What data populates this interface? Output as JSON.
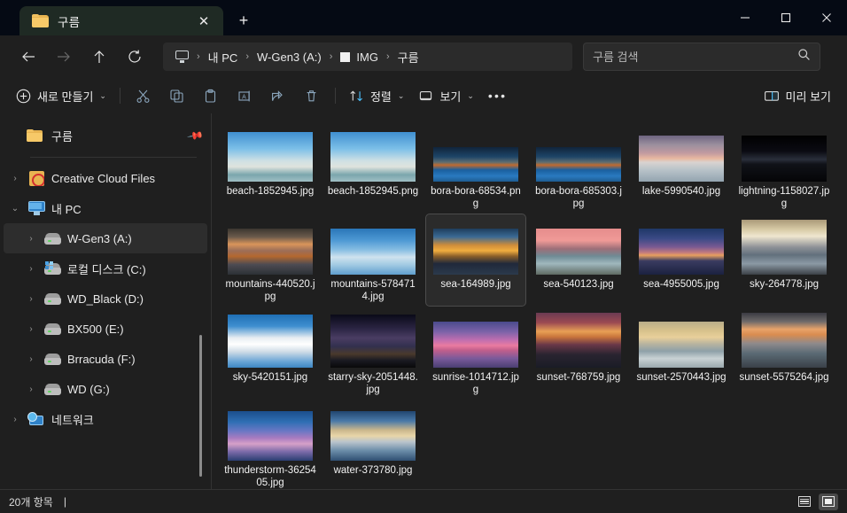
{
  "window": {
    "titlebar_color": "#050a14",
    "controls": [
      {
        "name": "minimize",
        "glyph": "minimize-icon"
      },
      {
        "name": "maximize",
        "glyph": "maximize-icon"
      },
      {
        "name": "close",
        "glyph": "close-icon"
      }
    ]
  },
  "tab": {
    "title": "구름",
    "icon": "folder-icon",
    "close_label": "✕",
    "newtab_label": "+"
  },
  "nav": {
    "back": "←",
    "forward": "→",
    "up": "↑",
    "refresh": "⟳"
  },
  "breadcrumb": {
    "items": [
      {
        "icon": "monitor-icon",
        "label": ""
      },
      {
        "icon": "",
        "label": "내 PC"
      },
      {
        "icon": "",
        "label": "W-Gen3 (A:)"
      },
      {
        "icon": "white-square-icon",
        "label": "IMG"
      },
      {
        "icon": "",
        "label": "구름"
      }
    ],
    "separator": "›"
  },
  "search": {
    "placeholder": "구름 검색",
    "value": "",
    "icon": "search-icon"
  },
  "toolbar": {
    "new_label": "새로 만들기",
    "chevron": "⌄",
    "cut_icon": "scissors-icon",
    "copy_icon": "copy-icon",
    "paste_icon": "clipboard-icon",
    "rename_icon": "rename-icon",
    "share_icon": "share-icon",
    "delete_icon": "trash-icon",
    "sort_label": "정렬",
    "view_label": "보기",
    "more_label": "•••",
    "preview_label": "미리 보기",
    "accent_color": "#4cc2ff"
  },
  "sidebar": {
    "pinned": {
      "label": "구름",
      "icon": "folder-icon",
      "pin_icon": "pin-icon"
    },
    "items": [
      {
        "label": "Creative Cloud Files",
        "icon": "creative-cloud-icon",
        "chevron": "›",
        "indent": 0,
        "selected": false
      },
      {
        "label": "내 PC",
        "icon": "this-pc-icon",
        "chevron": "⌄",
        "indent": 0,
        "selected": false
      },
      {
        "label": "W-Gen3 (A:)",
        "icon": "drive-icon",
        "chevron": "›",
        "indent": 1,
        "selected": true
      },
      {
        "label": "로컬 디스크 (C:)",
        "icon": "windows-drive-icon",
        "chevron": "›",
        "indent": 1,
        "selected": false
      },
      {
        "label": "WD_Black (D:)",
        "icon": "drive-icon",
        "chevron": "›",
        "indent": 1,
        "selected": false
      },
      {
        "label": "BX500 (E:)",
        "icon": "drive-icon",
        "chevron": "›",
        "indent": 1,
        "selected": false
      },
      {
        "label": "Brracuda (F:)",
        "icon": "drive-icon",
        "chevron": "›",
        "indent": 1,
        "selected": false
      },
      {
        "label": "WD (G:)",
        "icon": "drive-icon",
        "chevron": "›",
        "indent": 1,
        "selected": false
      },
      {
        "label": "네트워크",
        "icon": "network-icon",
        "chevron": "›",
        "indent": 0,
        "selected": false
      }
    ]
  },
  "files": [
    {
      "name": "beach-1852945.jpg",
      "selected": false,
      "w": 96,
      "h": 56,
      "grad": "linear-gradient(#3f8fd0 0%,#7dc0e8 34%,#cfe0e4 58%,#dfe3de 70%,#7ba6ad 86%,#9fbfc4 100%)"
    },
    {
      "name": "beach-1852945.png",
      "selected": false,
      "w": 96,
      "h": 56,
      "grad": "linear-gradient(#3f8fd0 0%,#7dc0e8 34%,#cfe0e4 58%,#dfe3de 70%,#7ba6ad 86%,#9fbfc4 100%)"
    },
    {
      "name": "bora-bora-68534.png",
      "selected": false,
      "w": 96,
      "h": 39,
      "grad": "linear-gradient(#10243a 0%,#1d4568 28%,#5f6d70 44%,#c06b30 52%,#1a5f9e 66%,#2a7ac0 84%,#1e5c91 100%)"
    },
    {
      "name": "bora-bora-685303.jpg",
      "selected": false,
      "w": 96,
      "h": 39,
      "grad": "linear-gradient(#10243a 0%,#1d4568 28%,#5f6d70 44%,#c06b30 52%,#1a5f9e 66%,#2a7ac0 84%,#1e5c91 100%)"
    },
    {
      "name": "lake-5990540.jpg",
      "selected": false,
      "w": 96,
      "h": 52,
      "grad": "linear-gradient(#6d6480 0%,#9b8f9e 20%,#c29aa0 38%,#e8b8a0 50%,#d9d3d0 58%,#b9c3c9 74%,#93a4b0 100%)"
    },
    {
      "name": "lightning-1158027.jpg",
      "selected": false,
      "w": 96,
      "h": 52,
      "grad": "linear-gradient(#000000 0%,#0b0b12 34%,#2a2f3b 52%,#101218 62%,#050507 100%)"
    },
    {
      "name": "mountains-440520.jpg",
      "selected": false,
      "w": 96,
      "h": 52,
      "grad": "linear-gradient(#3b3630 0%,#6a5a4c 18%,#d9955a 34%,#9c6e58 48%,#b4682f 60%,#4d4b52 78%,#2c3136 100%)"
    },
    {
      "name": "mountains-5784714.jpg",
      "selected": false,
      "w": 96,
      "h": 52,
      "grad": "linear-gradient(#2a76b8 0%,#4f9ad4 26%,#86bde2 46%,#cfe2ee 62%,#9ec8e2 80%,#5f9ece 100%)"
    },
    {
      "name": "sea-164989.jpg",
      "selected": true,
      "w": 96,
      "h": 52,
      "grad": "linear-gradient(#1f3d5c 0%,#3b6a94 18%,#cf8d3a 36%,#f0ad3f 48%,#8a5f2a 60%,#20283a 76%,#2b3a4c 100%)"
    },
    {
      "name": "sea-540123.jpg",
      "selected": false,
      "w": 96,
      "h": 52,
      "grad": "linear-gradient(#e58c8c 0%,#f09a97 26%,#9d6f78 44%,#6f8b95 60%,#9fb7bd 76%,#5f6a62 100%)"
    },
    {
      "name": "sea-4955005.jpg",
      "selected": false,
      "w": 96,
      "h": 52,
      "grad": "linear-gradient(#1f3767 0%,#3b4a86 22%,#7a5a92 40%,#c27a7e 52%,#e8a05f 58%,#3a3c60 70%,#1b2140 100%)"
    },
    {
      "name": "sky-264778.jpg",
      "selected": false,
      "w": 96,
      "h": 62,
      "grad": "linear-gradient(#a99878 0%,#d8cba6 18%,#efe6cf 30%,#8e9197 50%,#62707c 64%,#8b99a4 80%,#3b4046 100%)"
    },
    {
      "name": "sky-5420151.jpg",
      "selected": false,
      "w": 96,
      "h": 60,
      "grad": "linear-gradient(#1f6fb5 0%,#3f8fd0 22%,#e9eef2 44%,#ffffff 56%,#cfdce6 70%,#6ba6d6 88%,#3d86c2 100%)"
    },
    {
      "name": "starry-sky-2051448.jpg",
      "selected": false,
      "w": 96,
      "h": 60,
      "grad": "linear-gradient(#0a0a18 0%,#2a2442 26%,#4a3d63 44%,#32304e 60%,#4a3a2c 74%,#1a1a22 86%,#090909 100%)"
    },
    {
      "name": "sunrise-1014712.jpg",
      "selected": false,
      "w": 96,
      "h": 52,
      "grad": "linear-gradient(#4a4a8c 0%,#7c63a8 22%,#c06eb0 40%,#ea7ba0 52%,#c25f8c 62%,#7a5a9a 80%,#4a3e72 100%)"
    },
    {
      "name": "sunset-768759.jpg",
      "selected": false,
      "w": 96,
      "h": 62,
      "grad": "linear-gradient(#6a3a52 0%,#9c4a52 18%,#e8a055 34%,#c8743c 44%,#6a3848 58%,#2a2430 76%,#1a1c26 100%)"
    },
    {
      "name": "sunset-2570443.jpg",
      "selected": false,
      "w": 96,
      "h": 52,
      "grad": "linear-gradient(#b9ad8a 0%,#d8c28c 20%,#e8cf9a 34%,#b9b49f 48%,#8ea0a8 64%,#c9d2d4 80%,#9aa8ac 100%)"
    },
    {
      "name": "sunset-5575264.jpg",
      "selected": false,
      "w": 96,
      "h": 62,
      "grad": "linear-gradient(#3a3a42 0%,#6e6a6a 16%,#e8a36a 30%,#d98c50 40%,#8e8a8c 56%,#5a6a74 74%,#3a4048 100%)"
    },
    {
      "name": "thunderstorm-3625405.jpg",
      "selected": false,
      "w": 96,
      "h": 56,
      "grad": "linear-gradient(#1b4e8c 0%,#2f6fb4 22%,#6a77c4 40%,#a77bc0 54%,#d6a0c8 66%,#7a6aa8 82%,#2a3e72 100%)"
    },
    {
      "name": "water-373780.jpg",
      "selected": false,
      "w": 96,
      "h": 56,
      "grad": "linear-gradient(#21456f 0%,#4a79a8 20%,#c9b68c 38%,#e8d5a8 50%,#b9c4cc 62%,#6a8ca8 80%,#2f4f72 100%)"
    }
  ],
  "status": {
    "item_count": "20개 항목",
    "cursor": "|",
    "view_details": "details-view-icon",
    "view_large": "large-icons-view-icon"
  }
}
